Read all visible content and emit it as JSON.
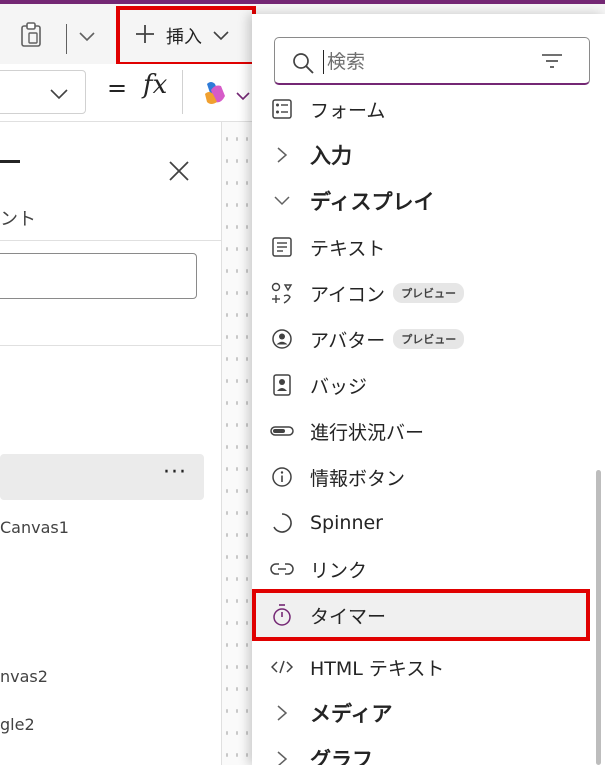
{
  "toolbar": {
    "insert_label": "挿入"
  },
  "left_panel": {
    "subtitle": "ント",
    "items": [
      "Canvas1",
      "nvas2",
      "gle2"
    ]
  },
  "flyout": {
    "search_placeholder": "検索",
    "items": [
      {
        "label": "フォーム",
        "icon": "form-icon"
      },
      {
        "label": "入力",
        "icon": "chevron-right-icon"
      },
      {
        "label": "ディスプレイ",
        "icon": "chevron-down-icon"
      },
      {
        "label": "テキスト",
        "icon": "text-icon"
      },
      {
        "label": "アイコン",
        "icon": "icons-icon",
        "badge": "プレビュー"
      },
      {
        "label": "アバター",
        "icon": "avatar-icon",
        "badge": "プレビュー"
      },
      {
        "label": "バッジ",
        "icon": "badge-icon"
      },
      {
        "label": "進行状況バー",
        "icon": "progress-bar-icon"
      },
      {
        "label": "情報ボタン",
        "icon": "info-icon"
      },
      {
        "label": "Spinner",
        "icon": "spinner-icon"
      },
      {
        "label": "リンク",
        "icon": "link-icon"
      },
      {
        "label": "タイマー",
        "icon": "timer-icon"
      },
      {
        "label": "HTML テキスト",
        "icon": "html-icon"
      },
      {
        "label": "メディア",
        "icon": "chevron-right-icon"
      },
      {
        "label": "グラフ",
        "icon": "chevron-right-icon"
      }
    ]
  },
  "colors": {
    "accent": "#742774",
    "highlight_border": "#e00000"
  }
}
